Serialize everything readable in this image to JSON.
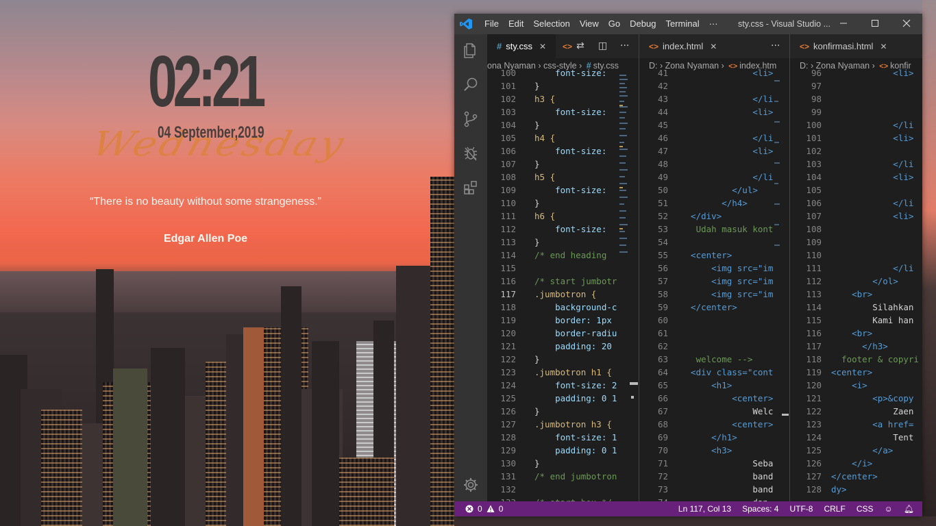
{
  "widget": {
    "time": "02:21",
    "date": "04 September,2019",
    "weekday": "Wednesday",
    "quote": "“There is no beauty without some strangeness.”",
    "author": "Edgar Allen Poe"
  },
  "window": {
    "menu": [
      "File",
      "Edit",
      "Selection",
      "View",
      "Go",
      "Debug",
      "Terminal",
      "···"
    ],
    "title": "sty.css - Visual Studio ...",
    "controls": [
      "minimize",
      "maximize",
      "close"
    ]
  },
  "activity_bar": [
    "explorer",
    "search",
    "source-control",
    "debug",
    "extensions",
    "settings"
  ],
  "colors": {
    "statusbar": "#68217a",
    "editor_bg": "#1e1e1e",
    "keyword_blue": "#569cd6",
    "selector_yellow": "#d7ba7d",
    "tag_blue": "#569cd6",
    "comment_green": "#6a9955",
    "string_orange": "#ce9178",
    "property_blue": "#9cdcfe"
  },
  "editors": [
    {
      "tabs": [
        {
          "label": "sty.css",
          "kind": "css",
          "active": true
        },
        {
          "label": "",
          "kind": "html",
          "active": false
        }
      ],
      "breadcrumb": [
        "ona Nyaman",
        "css-style",
        "sty.css"
      ],
      "lines": [
        {
          "n": "100",
          "t": "    font-size:",
          "c": "prop"
        },
        {
          "n": "101",
          "t": "}",
          "c": "plain"
        },
        {
          "n": "102",
          "t": "h3 {",
          "c": "sel"
        },
        {
          "n": "103",
          "t": "    font-size:",
          "c": "prop"
        },
        {
          "n": "104",
          "t": "}",
          "c": "plain"
        },
        {
          "n": "105",
          "t": "h4 {",
          "c": "sel"
        },
        {
          "n": "106",
          "t": "    font-size:",
          "c": "prop"
        },
        {
          "n": "107",
          "t": "}",
          "c": "plain"
        },
        {
          "n": "108",
          "t": "h5 {",
          "c": "sel"
        },
        {
          "n": "109",
          "t": "    font-size:",
          "c": "prop"
        },
        {
          "n": "110",
          "t": "}",
          "c": "plain"
        },
        {
          "n": "111",
          "t": "h6 {",
          "c": "sel"
        },
        {
          "n": "112",
          "t": "    font-size:",
          "c": "prop"
        },
        {
          "n": "113",
          "t": "}",
          "c": "plain"
        },
        {
          "n": "114",
          "t": "/* end heading",
          "c": "comment"
        },
        {
          "n": "115",
          "t": "",
          "c": "plain"
        },
        {
          "n": "116",
          "t": "/* start jumbotr",
          "c": "comment"
        },
        {
          "n": "117",
          "t": ".jumbotron {",
          "c": "sel"
        },
        {
          "n": "118",
          "t": "    background-c",
          "c": "prop"
        },
        {
          "n": "119",
          "t": "    border: 1px",
          "c": "prop"
        },
        {
          "n": "120",
          "t": "    border-radiu",
          "c": "prop"
        },
        {
          "n": "121",
          "t": "    padding: 20",
          "c": "prop"
        },
        {
          "n": "122",
          "t": "}",
          "c": "plain"
        },
        {
          "n": "123",
          "t": ".jumbotron h1 {",
          "c": "sel"
        },
        {
          "n": "124",
          "t": "    font-size: 2",
          "c": "prop"
        },
        {
          "n": "125",
          "t": "    padding: 0 1",
          "c": "prop"
        },
        {
          "n": "126",
          "t": "}",
          "c": "plain"
        },
        {
          "n": "127",
          "t": ".jumbotron h3 {",
          "c": "sel"
        },
        {
          "n": "128",
          "t": "    font-size: 1",
          "c": "prop"
        },
        {
          "n": "129",
          "t": "    padding: 0 1",
          "c": "prop"
        },
        {
          "n": "130",
          "t": "}",
          "c": "plain"
        },
        {
          "n": "131",
          "t": "/* end jumbotron",
          "c": "comment"
        },
        {
          "n": "132",
          "t": "",
          "c": "plain"
        },
        {
          "n": "133",
          "t": "/* start box */",
          "c": "comment"
        }
      ]
    },
    {
      "tabs": [
        {
          "label": "index.html",
          "kind": "html",
          "active": false
        }
      ],
      "breadcrumb": [
        "D:",
        "Zona Nyaman",
        "index.htm"
      ],
      "lines": [
        {
          "n": "41",
          "t": "              <li>",
          "c": "tag"
        },
        {
          "n": "42",
          "t": "",
          "c": "plain"
        },
        {
          "n": "43",
          "t": "              </li",
          "c": "tag"
        },
        {
          "n": "44",
          "t": "              <li>",
          "c": "tag"
        },
        {
          "n": "45",
          "t": "",
          "c": "plain"
        },
        {
          "n": "46",
          "t": "              </li",
          "c": "tag"
        },
        {
          "n": "47",
          "t": "              <li>",
          "c": "tag"
        },
        {
          "n": "48",
          "t": "",
          "c": "plain"
        },
        {
          "n": "49",
          "t": "              </li",
          "c": "tag"
        },
        {
          "n": "50",
          "t": "          </ul>",
          "c": "tag"
        },
        {
          "n": "51",
          "t": "        </h4>",
          "c": "tag"
        },
        {
          "n": "52",
          "t": "  </div>",
          "c": "tag"
        },
        {
          "n": "53",
          "t": "   Udah masuk kont",
          "c": "comment"
        },
        {
          "n": "54",
          "t": "",
          "c": "plain"
        },
        {
          "n": "55",
          "t": "  <center>",
          "c": "tag"
        },
        {
          "n": "56",
          "t": "      <img src=\"im",
          "c": "tag"
        },
        {
          "n": "57",
          "t": "      <img src=\"im",
          "c": "tag"
        },
        {
          "n": "58",
          "t": "      <img src=\"im",
          "c": "tag"
        },
        {
          "n": "59",
          "t": "  </center>",
          "c": "tag"
        },
        {
          "n": "60",
          "t": "",
          "c": "plain"
        },
        {
          "n": "61",
          "t": "",
          "c": "plain"
        },
        {
          "n": "62",
          "t": "",
          "c": "plain"
        },
        {
          "n": "63",
          "t": "   welcome -->",
          "c": "comment"
        },
        {
          "n": "64",
          "t": "  <div class=\"cont",
          "c": "tag"
        },
        {
          "n": "65",
          "t": "      <h1>",
          "c": "tag"
        },
        {
          "n": "66",
          "t": "          <center>",
          "c": "tag"
        },
        {
          "n": "67",
          "t": "              Welc",
          "c": "plain"
        },
        {
          "n": "68",
          "t": "          <center>",
          "c": "tag"
        },
        {
          "n": "69",
          "t": "      </h1>",
          "c": "tag"
        },
        {
          "n": "70",
          "t": "      <h3>",
          "c": "tag"
        },
        {
          "n": "71",
          "t": "              Seba",
          "c": "plain"
        },
        {
          "n": "72",
          "t": "              band",
          "c": "plain"
        },
        {
          "n": "73",
          "t": "              band",
          "c": "plain"
        },
        {
          "n": "74",
          "t": "              dan",
          "c": "plain"
        }
      ]
    },
    {
      "tabs": [
        {
          "label": "konfirmasi.html",
          "kind": "html",
          "active": false
        }
      ],
      "breadcrumb": [
        "D:",
        "Zona Nyaman",
        "konfir"
      ],
      "lines": [
        {
          "n": "96",
          "t": "            <li>",
          "c": "tag"
        },
        {
          "n": "97",
          "t": "",
          "c": "plain"
        },
        {
          "n": "98",
          "t": "",
          "c": "plain"
        },
        {
          "n": "99",
          "t": "",
          "c": "plain"
        },
        {
          "n": "100",
          "t": "            </li",
          "c": "tag"
        },
        {
          "n": "101",
          "t": "            <li>",
          "c": "tag"
        },
        {
          "n": "102",
          "t": "",
          "c": "plain"
        },
        {
          "n": "103",
          "t": "            </li",
          "c": "tag"
        },
        {
          "n": "104",
          "t": "            <li>",
          "c": "tag"
        },
        {
          "n": "105",
          "t": "",
          "c": "plain"
        },
        {
          "n": "106",
          "t": "            </li",
          "c": "tag"
        },
        {
          "n": "107",
          "t": "            <li>",
          "c": "tag"
        },
        {
          "n": "108",
          "t": "",
          "c": "plain"
        },
        {
          "n": "109",
          "t": "",
          "c": "plain"
        },
        {
          "n": "110",
          "t": "",
          "c": "plain"
        },
        {
          "n": "111",
          "t": "            </li",
          "c": "tag"
        },
        {
          "n": "112",
          "t": "        </ol>",
          "c": "tag"
        },
        {
          "n": "113",
          "t": "    <br>",
          "c": "tag"
        },
        {
          "n": "114",
          "t": "        Silahkan",
          "c": "plain"
        },
        {
          "n": "115",
          "t": "        Kami han",
          "c": "plain"
        },
        {
          "n": "116",
          "t": "    <br>",
          "c": "tag"
        },
        {
          "n": "117",
          "t": "      </h3>",
          "c": "tag"
        },
        {
          "n": "118",
          "t": "  footer & copyri",
          "c": "comment"
        },
        {
          "n": "119",
          "t": "<center>",
          "c": "tag"
        },
        {
          "n": "120",
          "t": "    <i>",
          "c": "tag"
        },
        {
          "n": "121",
          "t": "        <p>&copy",
          "c": "tag"
        },
        {
          "n": "122",
          "t": "            Zaen",
          "c": "plain"
        },
        {
          "n": "123",
          "t": "        <a href=",
          "c": "tag"
        },
        {
          "n": "124",
          "t": "            Tent",
          "c": "plain"
        },
        {
          "n": "125",
          "t": "        </a>",
          "c": "tag"
        },
        {
          "n": "126",
          "t": "    </i>",
          "c": "tag"
        },
        {
          "n": "127",
          "t": "</center>",
          "c": "tag"
        },
        {
          "n": "128",
          "t": "dy>",
          "c": "tag"
        }
      ]
    }
  ],
  "statusbar": {
    "errors": "0",
    "warnings": "0",
    "cursor": "Ln 117, Col 13",
    "spaces": "Spaces: 4",
    "encoding": "UTF-8",
    "eol": "CRLF",
    "language": "CSS"
  }
}
